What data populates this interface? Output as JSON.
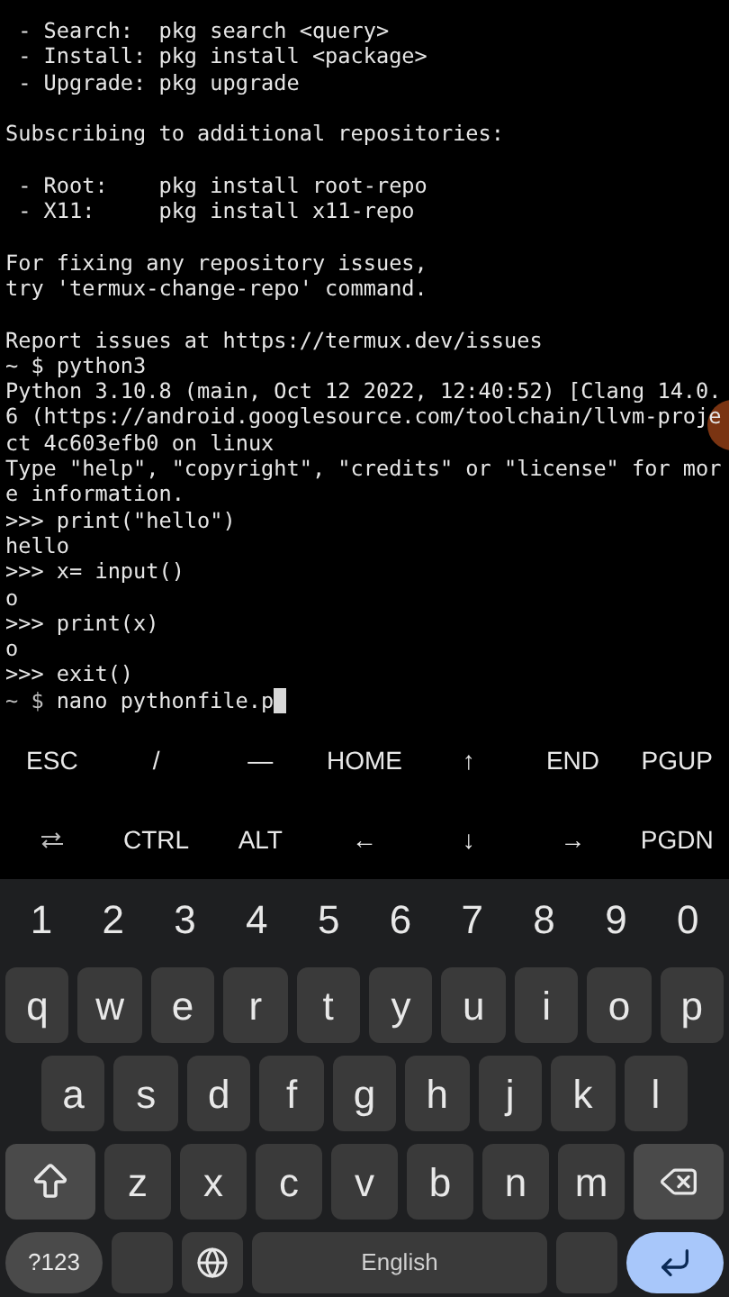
{
  "terminal": {
    "blocks": [
      [
        " - Search:  pkg search <query>",
        " - Install: pkg install <package>",
        " - Upgrade: pkg upgrade"
      ],
      [
        "Subscribing to additional repositories:"
      ],
      [
        " - Root:    pkg install root-repo",
        " - X11:     pkg install x11-repo"
      ],
      [
        "For fixing any repository issues,",
        "try 'termux-change-repo' command."
      ],
      [
        "Report issues at https://termux.dev/issues",
        "~ $ python3",
        "Python 3.10.8 (main, Oct 12 2022, 12:40:52) [Clang 14.0.",
        "6 (https://android.googlesource.com/toolchain/llvm-proje",
        "ct 4c603efb0 on linux",
        "Type \"help\", \"copyright\", \"credits\" or \"license\" for mor",
        "e information.",
        ">>> print(\"hello\")",
        "hello",
        ">>> x= input()",
        "o",
        ">>> print(x)",
        "o",
        ">>> exit()"
      ]
    ],
    "input_line": {
      "prompt": "~ $",
      "text": "nano pythonfile.p",
      "cursor": true
    }
  },
  "extra_keys": [
    [
      {
        "kind": "text",
        "label": "ESC"
      },
      {
        "kind": "text",
        "label": "/"
      },
      {
        "kind": "text",
        "label": "—"
      },
      {
        "kind": "text",
        "label": "HOME"
      },
      {
        "kind": "text",
        "label": "↑"
      },
      {
        "kind": "text",
        "label": "END"
      },
      {
        "kind": "text",
        "label": "PGUP"
      }
    ],
    [
      {
        "kind": "tab"
      },
      {
        "kind": "text",
        "label": "CTRL"
      },
      {
        "kind": "text",
        "label": "ALT"
      },
      {
        "kind": "text",
        "label": "←"
      },
      {
        "kind": "text",
        "label": "↓"
      },
      {
        "kind": "text",
        "label": "→"
      },
      {
        "kind": "text",
        "label": "PGDN"
      }
    ]
  ],
  "keyboard": {
    "number_row": [
      "1",
      "2",
      "3",
      "4",
      "5",
      "6",
      "7",
      "8",
      "9",
      "0"
    ],
    "rows": [
      {
        "keys": [
          "q",
          "w",
          "e",
          "r",
          "t",
          "y",
          "u",
          "i",
          "o",
          "p"
        ]
      },
      {
        "keys": [
          "a",
          "s",
          "d",
          "f",
          "g",
          "h",
          "j",
          "k",
          "l"
        ]
      },
      {
        "lead": {
          "kind": "shift"
        },
        "keys": [
          "z",
          "x",
          "c",
          "v",
          "b",
          "n",
          "m"
        ],
        "trail": {
          "kind": "backspace"
        }
      }
    ],
    "bottom_row": [
      {
        "kind": "symbols",
        "label": "?123"
      },
      {
        "kind": "blank"
      },
      {
        "kind": "globe"
      },
      {
        "kind": "space",
        "label": "English"
      },
      {
        "kind": "blank"
      },
      {
        "kind": "enter"
      }
    ]
  }
}
